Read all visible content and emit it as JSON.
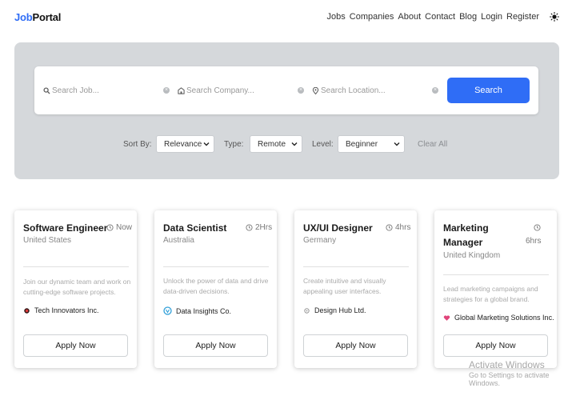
{
  "header": {
    "logo_part1": "Job",
    "logo_part2": "Portal",
    "nav": [
      "Jobs",
      "Companies",
      "About",
      "Contact",
      "Blog",
      "Login",
      "Register"
    ]
  },
  "search": {
    "job_placeholder": "Search Job...",
    "company_placeholder": "Search Company...",
    "location_placeholder": "Search Location...",
    "button_label": "Search"
  },
  "filters": {
    "sort_label": "Sort By:",
    "sort_value": "Relevance",
    "type_label": "Type:",
    "type_value": "Remote",
    "level_label": "Level:",
    "level_value": "Beginner",
    "clear_label": "Clear All"
  },
  "colors": {
    "accent": "#2f6df6",
    "panel": "#d5d8db"
  },
  "jobs": [
    {
      "title": "Software Engineer",
      "time": "Now",
      "location": "United States",
      "description": "Join our dynamic team and work on cutting-edge software projects.",
      "company": "Tech Innovators Inc.",
      "company_icon": "red-dot-icon",
      "apply_label": "Apply Now"
    },
    {
      "title": "Data Scientist",
      "time": "2Hrs",
      "location": "Australia",
      "description": "Unlock the power of data and drive data-driven decisions.",
      "company": "Data Insights Co.",
      "company_icon": "data-logo-icon",
      "apply_label": "Apply Now"
    },
    {
      "title": "UX/UI Designer",
      "time": "4hrs",
      "location": "Germany",
      "description": "Create intuitive and visually appealing user interfaces.",
      "company": "Design Hub Ltd.",
      "company_icon": "design-dot-icon",
      "apply_label": "Apply Now"
    },
    {
      "title": "Marketing Manager",
      "time": "6hrs",
      "location": "United Kingdom",
      "description": "Lead marketing campaigns and strategies for a global brand.",
      "company": "Global Marketing Solutions Inc.",
      "company_icon": "heart-icon",
      "apply_label": "Apply Now"
    }
  ],
  "watermark": {
    "line1": "Activate Windows",
    "line2": "Go to Settings to activate Windows."
  }
}
